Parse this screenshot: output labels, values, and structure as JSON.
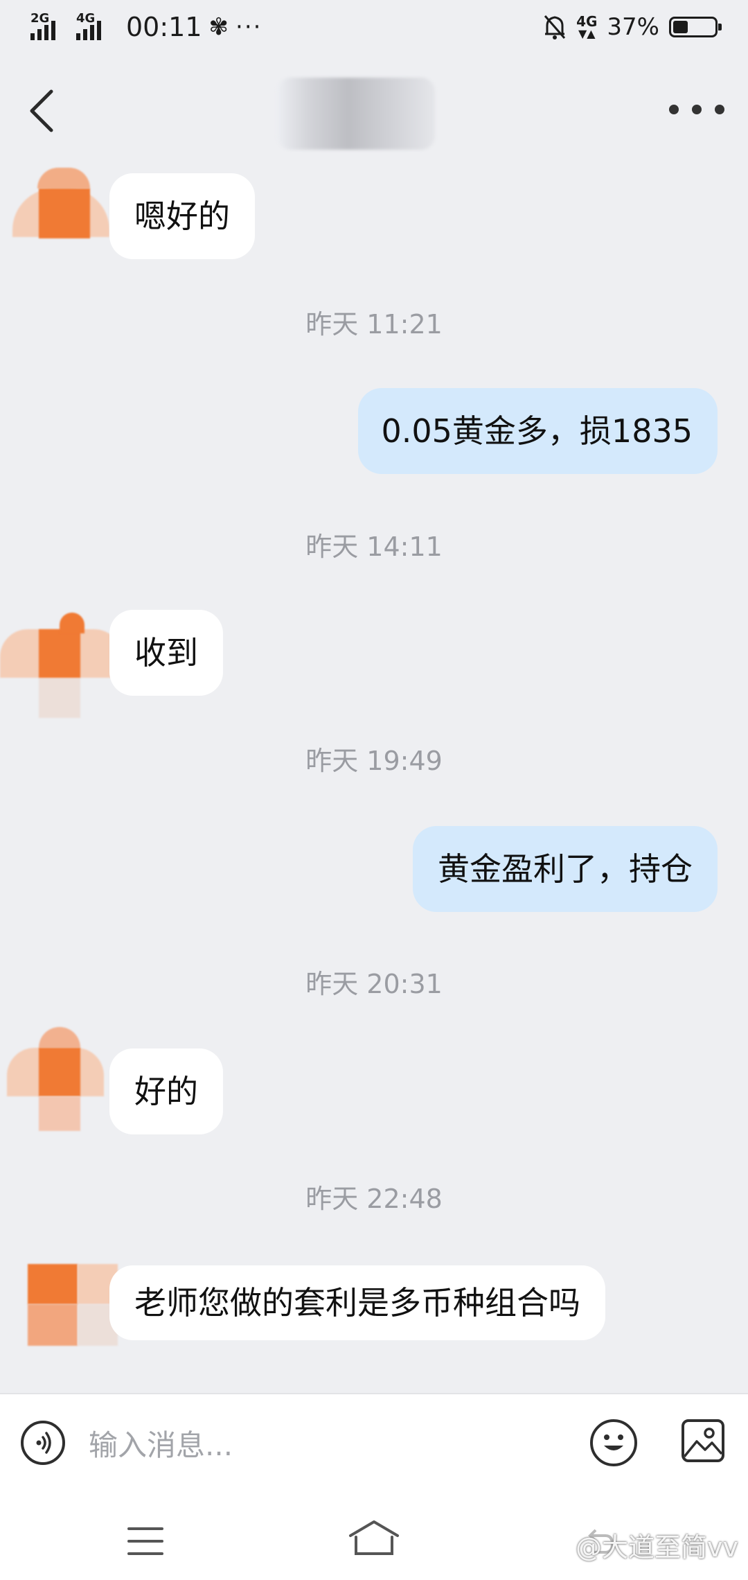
{
  "status_bar": {
    "signal1_label": "2G",
    "signal2_label": "4G",
    "time": "00:11",
    "network_badge": "4G",
    "battery_level": 37,
    "battery_text": "37%"
  },
  "header": {
    "title": "",
    "back_icon": "chevron-left-icon",
    "more_icon": "more-horizontal-icon"
  },
  "messages": [
    {
      "type": "in",
      "text": "嗯好的"
    },
    {
      "type": "timestamp",
      "text": "昨天 11:21"
    },
    {
      "type": "out",
      "text": "0.05黄金多，损1835"
    },
    {
      "type": "timestamp",
      "text": "昨天 14:11"
    },
    {
      "type": "in",
      "text": "收到"
    },
    {
      "type": "timestamp",
      "text": "昨天 19:49"
    },
    {
      "type": "out",
      "text": "黄金盈利了，持仓"
    },
    {
      "type": "timestamp",
      "text": "昨天 20:31"
    },
    {
      "type": "in",
      "text": "好的"
    },
    {
      "type": "timestamp",
      "text": "昨天 22:48"
    },
    {
      "type": "in",
      "text": "老师您做的套利是多币种组合吗"
    }
  ],
  "input": {
    "placeholder": "输入消息...",
    "voice_icon": "voice-icon",
    "emoji_icon": "emoji-icon",
    "image_icon": "image-icon"
  },
  "nav": {
    "menu_icon": "menu-icon",
    "home_icon": "home-icon",
    "back_icon": "back-icon"
  },
  "watermark": "@大道至简vv",
  "colors": {
    "background": "#eeeff2",
    "incoming_bubble": "#ffffff",
    "outgoing_bubble": "#d4e9fc",
    "timestamp_text": "#9a9ca2",
    "avatar_orange": "#f07a34"
  }
}
